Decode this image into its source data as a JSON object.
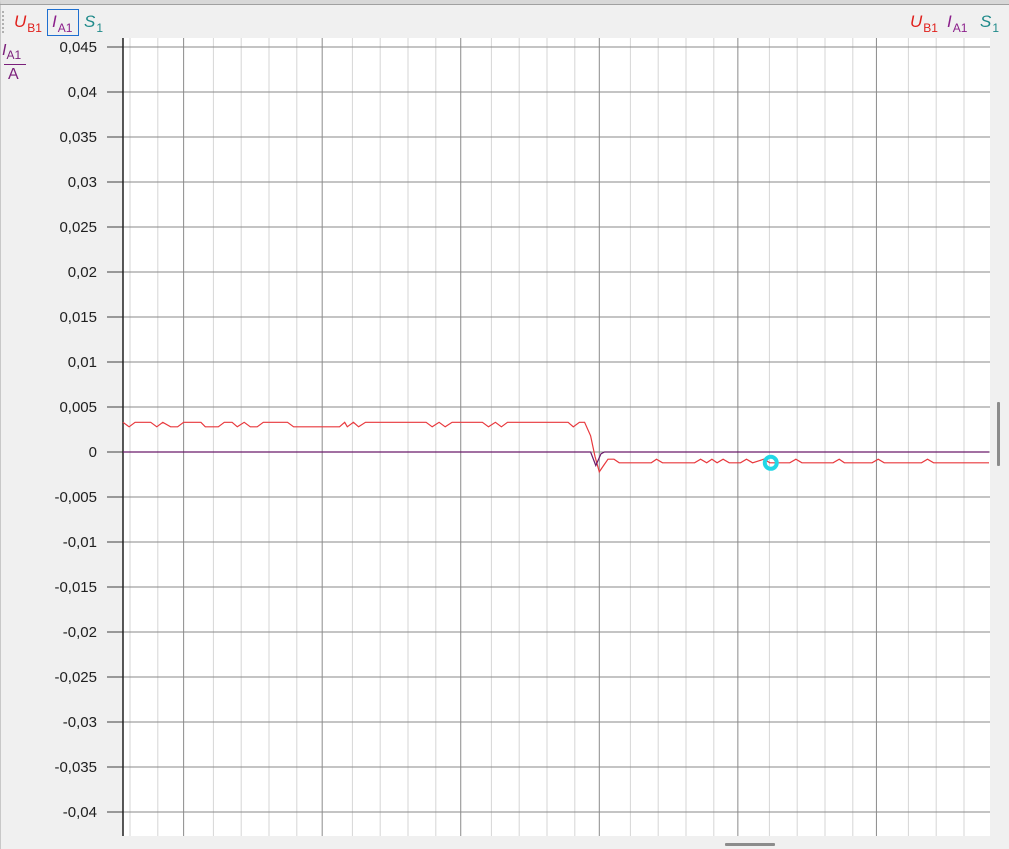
{
  "legend": {
    "left": [
      {
        "symbol": "U",
        "sub": "B1",
        "color": "#e0201c"
      },
      {
        "symbol": "I",
        "sub": "A1",
        "color": "#8b1f8b"
      },
      {
        "symbol": "S",
        "sub": "1",
        "color": "#1f8a8a"
      }
    ],
    "right": [
      {
        "symbol": "U",
        "sub": "B1",
        "color": "#e0201c"
      },
      {
        "symbol": "I",
        "sub": "A1",
        "color": "#8b1f8b"
      },
      {
        "symbol": "S",
        "sub": "1",
        "color": "#1f8a8a"
      }
    ]
  },
  "y_unit": {
    "symbol": "I",
    "sub": "A1",
    "unit": "A",
    "color": "#7a1f7a"
  },
  "chart_data": {
    "type": "line",
    "ylim": [
      -0.043,
      0.045
    ],
    "xlim": [
      0,
      100
    ],
    "grid": true,
    "y_ticks": [
      0.045,
      0.04,
      0.035,
      0.03,
      0.025,
      0.02,
      0.015,
      0.01,
      0.005,
      0,
      -0.005,
      -0.01,
      -0.015,
      -0.02,
      -0.025,
      -0.03,
      -0.035,
      -0.04
    ],
    "y_tick_labels": [
      "0,045",
      "0,04",
      "0,035",
      "0,03",
      "0,025",
      "0,02",
      "0,015",
      "0,01",
      "0,005",
      "0",
      "-0,005",
      "-0,01",
      "-0,015",
      "-0,02",
      "-0,025",
      "-0,03",
      "-0,035",
      "-0,04"
    ],
    "x_major_grid": [
      7,
      23,
      39,
      55,
      71,
      87
    ],
    "series": [
      {
        "name": "U B1",
        "color": "#e8383d",
        "points": [
          [
            0,
            0.0033
          ],
          [
            0.7,
            0.0028
          ],
          [
            1.4,
            0.0033
          ],
          [
            3.2,
            0.0033
          ],
          [
            3.9,
            0.0028
          ],
          [
            4.6,
            0.0033
          ],
          [
            5.5,
            0.0028
          ],
          [
            6.3,
            0.0028
          ],
          [
            7,
            0.0033
          ],
          [
            9,
            0.0033
          ],
          [
            9.5,
            0.0028
          ],
          [
            11,
            0.0028
          ],
          [
            11.7,
            0.0033
          ],
          [
            12.6,
            0.0033
          ],
          [
            13.2,
            0.0028
          ],
          [
            14,
            0.0033
          ],
          [
            14.7,
            0.0028
          ],
          [
            15.5,
            0.0028
          ],
          [
            16.2,
            0.0033
          ],
          [
            19,
            0.0033
          ],
          [
            19.7,
            0.0028
          ],
          [
            25,
            0.0028
          ],
          [
            25.6,
            0.0033
          ],
          [
            25.9,
            0.0028
          ],
          [
            26.6,
            0.0033
          ],
          [
            27.2,
            0.0028
          ],
          [
            28,
            0.0033
          ],
          [
            35,
            0.0033
          ],
          [
            35.7,
            0.0028
          ],
          [
            36.5,
            0.0033
          ],
          [
            37.2,
            0.0028
          ],
          [
            38,
            0.0033
          ],
          [
            41.5,
            0.0033
          ],
          [
            42.2,
            0.0028
          ],
          [
            43,
            0.0033
          ],
          [
            43.7,
            0.0028
          ],
          [
            44.4,
            0.0033
          ],
          [
            51.4,
            0.0033
          ],
          [
            52,
            0.0028
          ],
          [
            52.7,
            0.0033
          ],
          [
            53.3,
            0.0033
          ],
          [
            54,
            0.0018
          ],
          [
            54.5,
            -0.0005
          ],
          [
            55,
            -0.0022
          ],
          [
            55.5,
            -0.0015
          ],
          [
            56,
            -0.0008
          ],
          [
            56.7,
            -0.0008
          ],
          [
            57.3,
            -0.0012
          ],
          [
            61,
            -0.0012
          ],
          [
            61.6,
            -0.0008
          ],
          [
            62.3,
            -0.0012
          ],
          [
            66,
            -0.0012
          ],
          [
            66.7,
            -0.0008
          ],
          [
            67.4,
            -0.0012
          ],
          [
            68,
            -0.0008
          ],
          [
            68.6,
            -0.0012
          ],
          [
            69.3,
            -0.0008
          ],
          [
            70,
            -0.0012
          ],
          [
            71.3,
            -0.0012
          ],
          [
            72,
            -0.0008
          ],
          [
            72.7,
            -0.0012
          ],
          [
            74,
            -0.0008
          ],
          [
            74.7,
            -0.0012
          ],
          [
            77,
            -0.0012
          ],
          [
            77.7,
            -0.0008
          ],
          [
            78.4,
            -0.0012
          ],
          [
            82,
            -0.0012
          ],
          [
            82.7,
            -0.0008
          ],
          [
            83.3,
            -0.0012
          ],
          [
            86.5,
            -0.0012
          ],
          [
            87.2,
            -0.0008
          ],
          [
            87.9,
            -0.0012
          ],
          [
            92.2,
            -0.0012
          ],
          [
            92.9,
            -0.0008
          ],
          [
            93.6,
            -0.0012
          ],
          [
            100,
            -0.0012
          ]
        ]
      },
      {
        "name": "I A1",
        "color": "#6a1a6a",
        "points": [
          [
            0,
            0
          ],
          [
            54,
            0
          ],
          [
            54.6,
            -0.0015
          ],
          [
            55.2,
            -0.0002
          ],
          [
            55.6,
            0
          ],
          [
            100,
            0
          ]
        ]
      }
    ],
    "marker": {
      "x": 74.8,
      "y": -0.0012,
      "color": "#22d7e6"
    }
  }
}
